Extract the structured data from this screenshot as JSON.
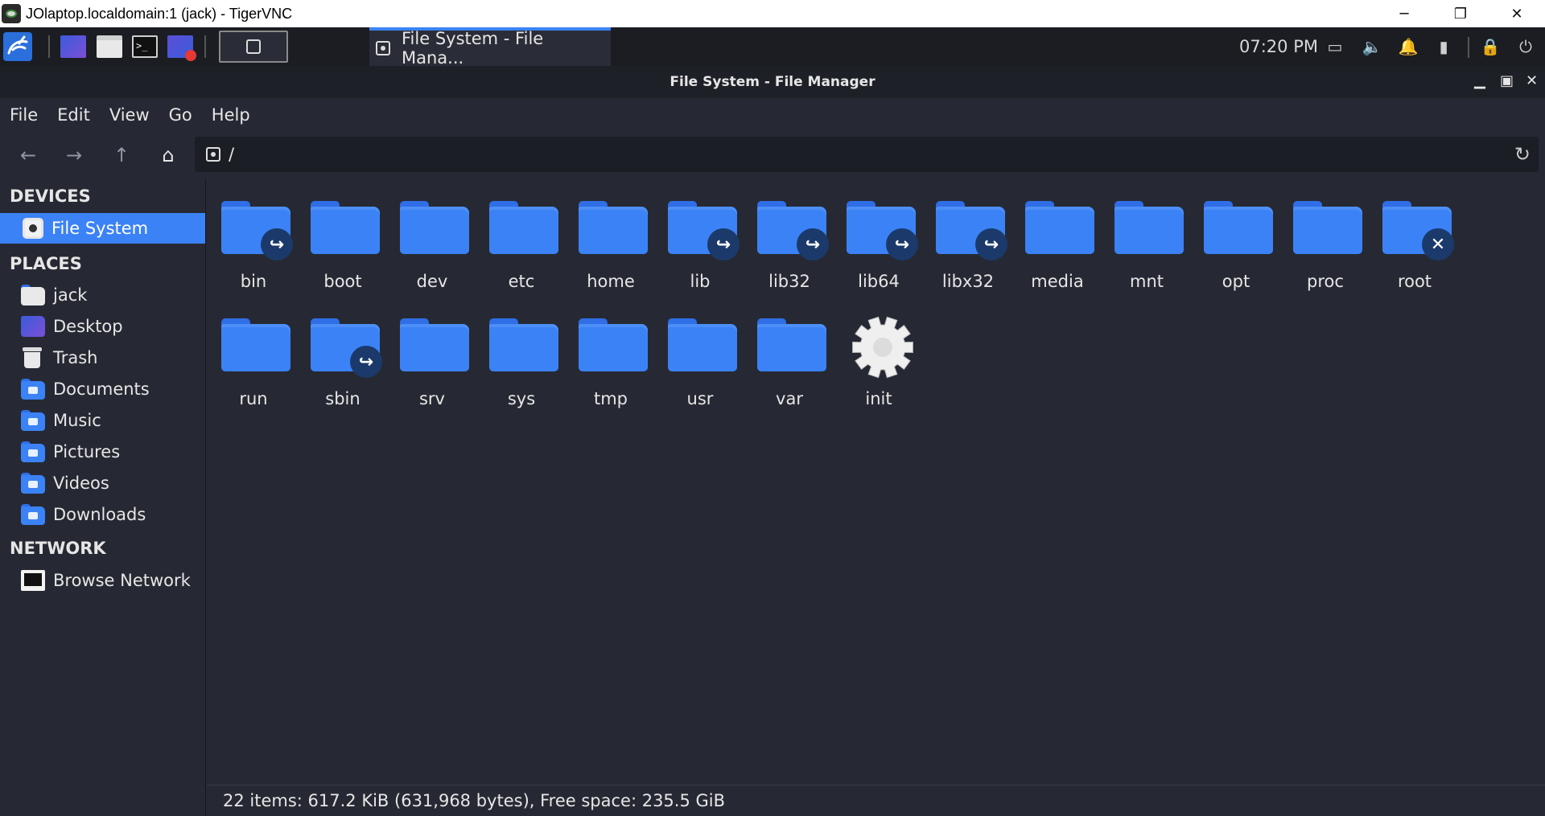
{
  "host_window": {
    "title": "JOlaptop.localdomain:1 (jack) - TigerVNC",
    "controls": [
      "─",
      "❐",
      "✕"
    ]
  },
  "panel": {
    "launchers": [
      "kali-menu-icon",
      "desktop-icon",
      "file-manager-icon",
      "terminal-icon",
      "screen-recorder-icon"
    ],
    "task": {
      "label": "File System - File Mana..."
    },
    "clock": "07:20 PM"
  },
  "fm": {
    "title": "File System - File Manager",
    "menu": [
      "File",
      "Edit",
      "View",
      "Go",
      "Help"
    ],
    "path": "/",
    "sidebar": {
      "devices_heading": "DEVICES",
      "devices": [
        {
          "label": "File System",
          "icon": "drive-icon"
        }
      ],
      "places_heading": "PLACES",
      "places": [
        {
          "label": "jack",
          "icon": "home-folder-icon"
        },
        {
          "label": "Desktop",
          "icon": "desktop-folder-icon"
        },
        {
          "label": "Trash",
          "icon": "trash-icon"
        },
        {
          "label": "Documents",
          "icon": "documents-folder-icon"
        },
        {
          "label": "Music",
          "icon": "music-folder-icon"
        },
        {
          "label": "Pictures",
          "icon": "pictures-folder-icon"
        },
        {
          "label": "Videos",
          "icon": "videos-folder-icon"
        },
        {
          "label": "Downloads",
          "icon": "downloads-folder-icon"
        }
      ],
      "network_heading": "NETWORK",
      "network": [
        {
          "label": "Browse Network",
          "icon": "network-icon"
        }
      ]
    },
    "items": [
      {
        "name": "bin",
        "type": "folder",
        "emblem": "symlink"
      },
      {
        "name": "boot",
        "type": "folder"
      },
      {
        "name": "dev",
        "type": "folder"
      },
      {
        "name": "etc",
        "type": "folder"
      },
      {
        "name": "home",
        "type": "folder"
      },
      {
        "name": "lib",
        "type": "folder",
        "emblem": "symlink"
      },
      {
        "name": "lib32",
        "type": "folder",
        "emblem": "symlink"
      },
      {
        "name": "lib64",
        "type": "folder",
        "emblem": "symlink"
      },
      {
        "name": "libx32",
        "type": "folder",
        "emblem": "symlink"
      },
      {
        "name": "media",
        "type": "folder"
      },
      {
        "name": "mnt",
        "type": "folder"
      },
      {
        "name": "opt",
        "type": "folder"
      },
      {
        "name": "proc",
        "type": "folder"
      },
      {
        "name": "root",
        "type": "folder",
        "emblem": "unreadable"
      },
      {
        "name": "run",
        "type": "folder"
      },
      {
        "name": "sbin",
        "type": "folder",
        "emblem": "symlink"
      },
      {
        "name": "srv",
        "type": "folder"
      },
      {
        "name": "sys",
        "type": "folder"
      },
      {
        "name": "tmp",
        "type": "folder"
      },
      {
        "name": "usr",
        "type": "folder"
      },
      {
        "name": "var",
        "type": "folder"
      },
      {
        "name": "init",
        "type": "executable"
      }
    ],
    "status": "22 items: 617.2 KiB (631,968 bytes), Free space: 235.5 GiB"
  },
  "colors": {
    "accent": "#3b82f6",
    "background": "#262933",
    "panel": "#1b1d23"
  }
}
